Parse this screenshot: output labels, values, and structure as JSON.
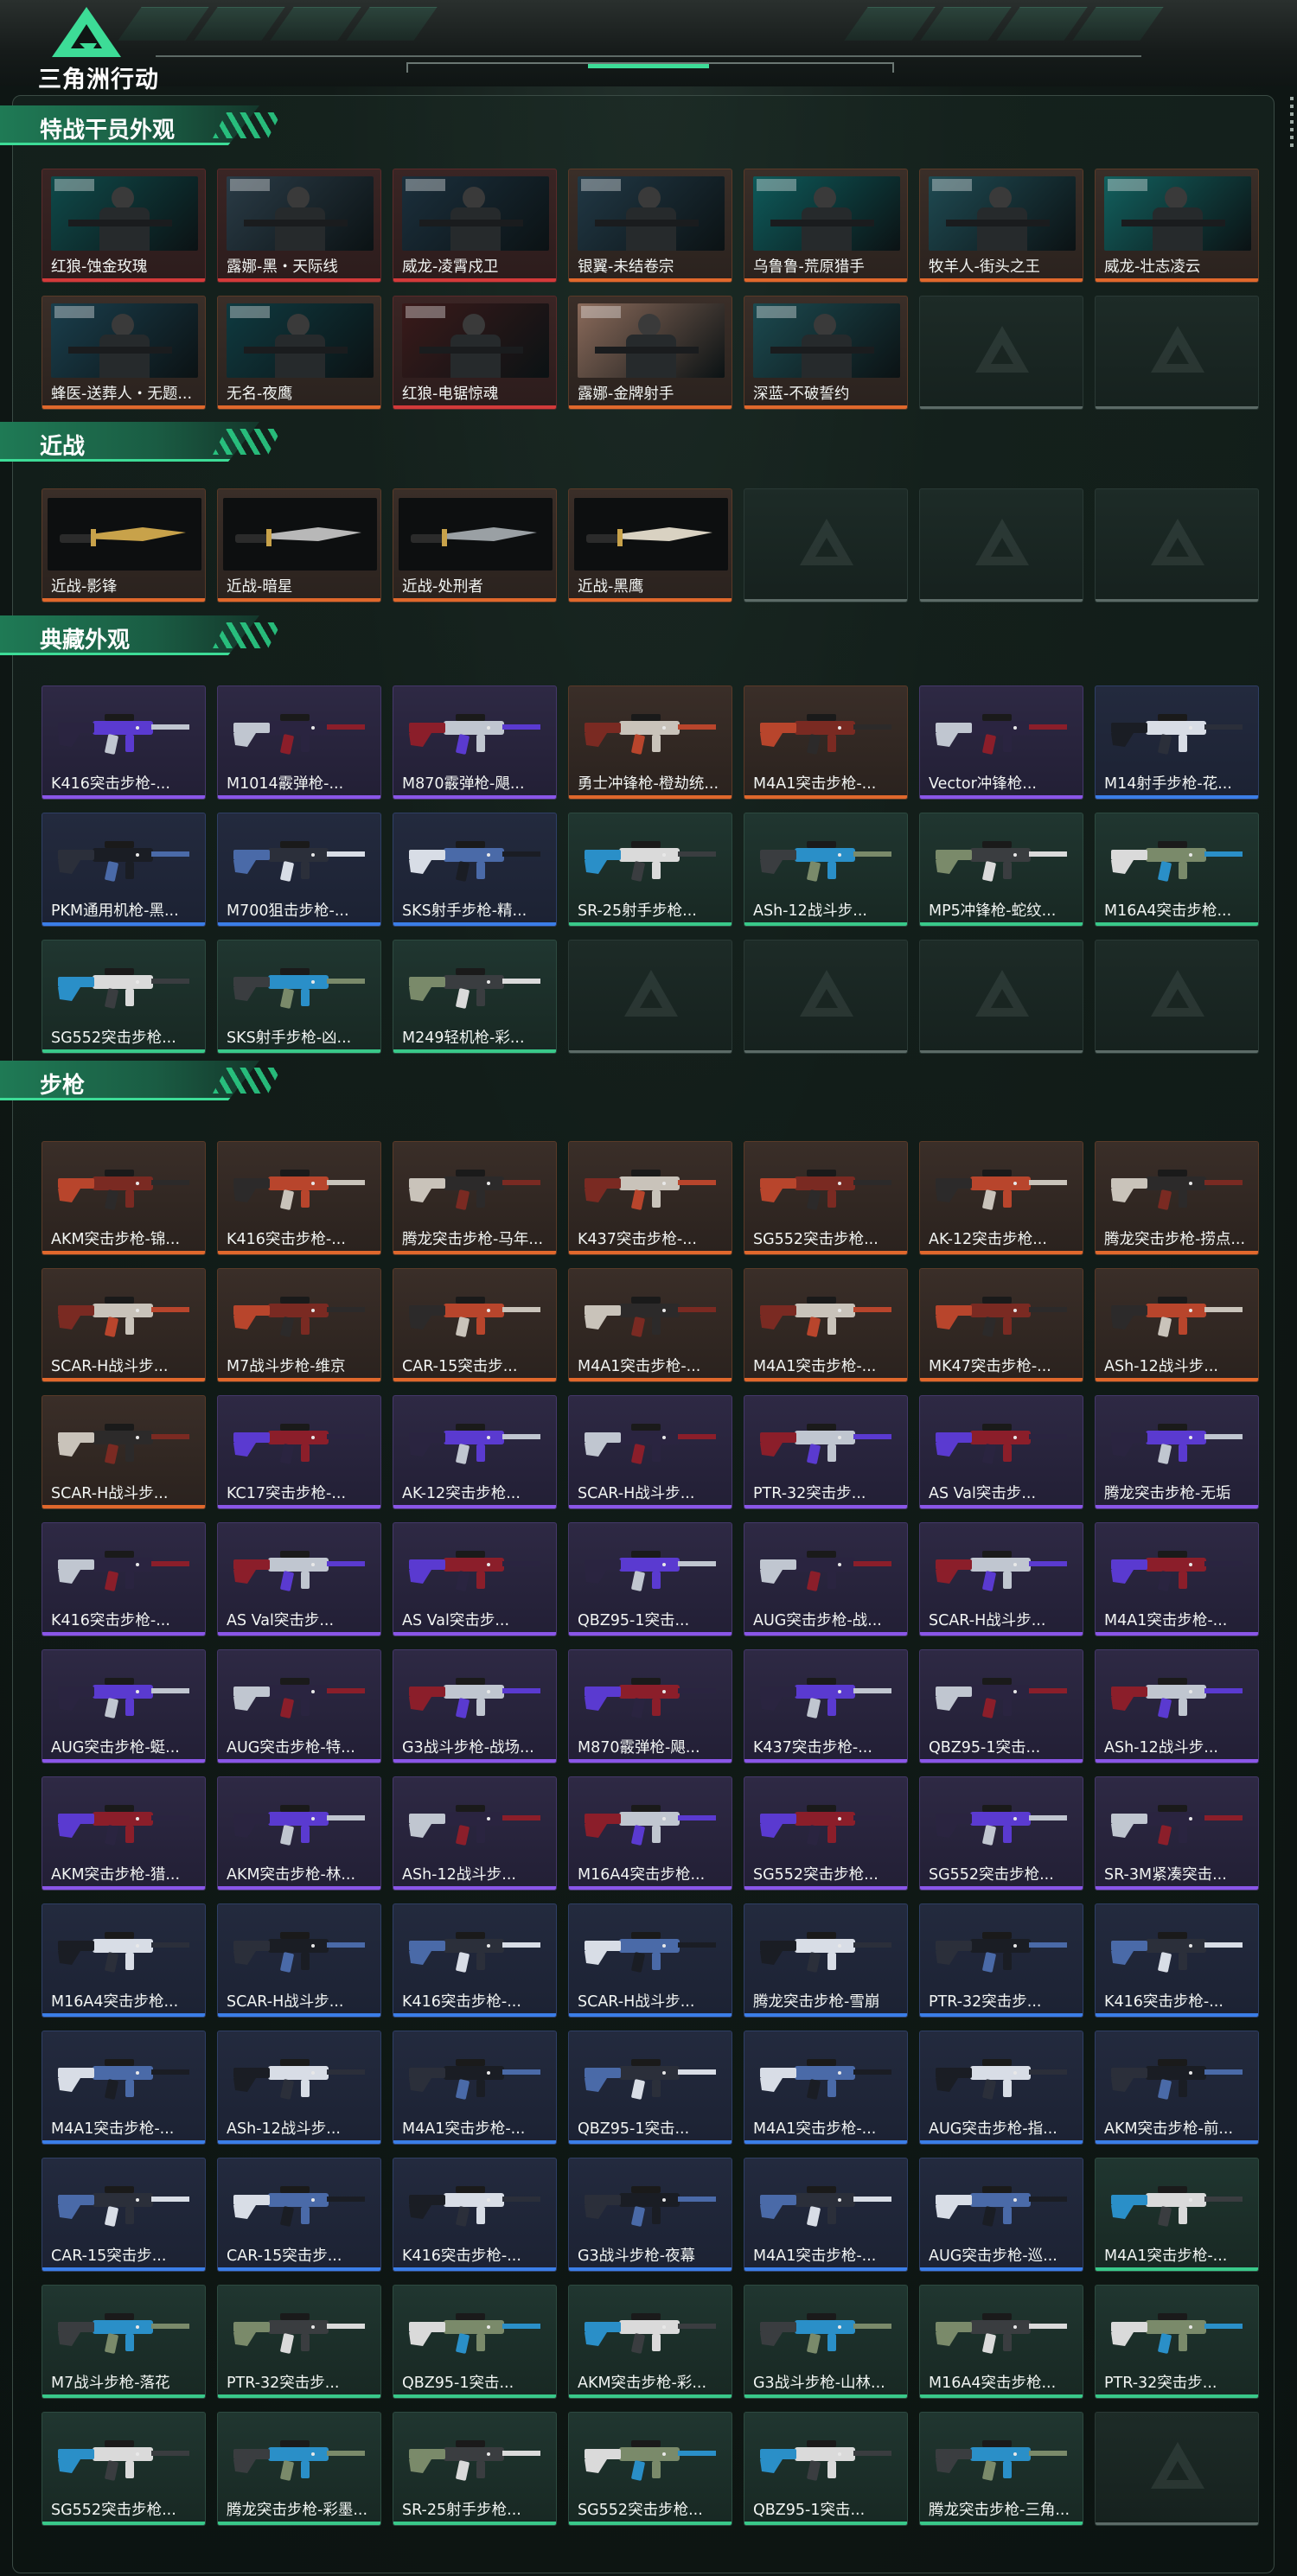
{
  "app": {
    "logo_text": "三角洲行动"
  },
  "colors": {
    "accent": "#3ddc97",
    "orange": "#e0682c",
    "red": "#d33a3a",
    "purple": "#8a56e8",
    "blue": "#3b7ee8",
    "green": "#39c98a"
  },
  "sections": [
    {
      "title": "特战干员外观",
      "kind": "operator",
      "items": [
        {
          "label": "红狼-蚀金玫瑰",
          "rarity": "red"
        },
        {
          "label": "露娜-黑・天际线",
          "rarity": "red"
        },
        {
          "label": "威龙-凌霄戍卫",
          "rarity": "red"
        },
        {
          "label": "银翼-未结卷宗",
          "rarity": "orange"
        },
        {
          "label": "乌鲁鲁-荒原猎手",
          "rarity": "orange"
        },
        {
          "label": "牧羊人-街头之王",
          "rarity": "orange"
        },
        {
          "label": "威龙-壮志凌云",
          "rarity": "orange"
        },
        {
          "label": "蜂医-送葬人・无题...",
          "rarity": "orange"
        },
        {
          "label": "无名-夜鹰",
          "rarity": "orange"
        },
        {
          "label": "红狼-电锯惊魂",
          "rarity": "red"
        },
        {
          "label": "露娜-金牌射手",
          "rarity": "orange"
        },
        {
          "label": "深蓝-不破誓约",
          "rarity": "orange"
        },
        {
          "label": "",
          "rarity": "empty"
        },
        {
          "label": "",
          "rarity": "empty"
        }
      ]
    },
    {
      "title": "近战",
      "kind": "melee",
      "items": [
        {
          "label": "近战-影锋",
          "rarity": "orange"
        },
        {
          "label": "近战-暗星",
          "rarity": "orange"
        },
        {
          "label": "近战-处刑者",
          "rarity": "orange"
        },
        {
          "label": "近战-黑鹰",
          "rarity": "orange"
        },
        {
          "label": "",
          "rarity": "empty"
        },
        {
          "label": "",
          "rarity": "empty"
        },
        {
          "label": "",
          "rarity": "empty"
        }
      ]
    },
    {
      "title": "典藏外观",
      "kind": "gun",
      "items": [
        {
          "label": "K416突击步枪-...",
          "rarity": "purple"
        },
        {
          "label": "M1014霰弹枪-...",
          "rarity": "purple"
        },
        {
          "label": "M870霰弹枪-飓...",
          "rarity": "purple"
        },
        {
          "label": "勇士冲锋枪-橙劫统...",
          "rarity": "orange"
        },
        {
          "label": "M4A1突击步枪-...",
          "rarity": "orange"
        },
        {
          "label": "Vector冲锋枪...",
          "rarity": "purple"
        },
        {
          "label": "M14射手步枪-花...",
          "rarity": "blue"
        },
        {
          "label": "PKM通用机枪-黑...",
          "rarity": "blue"
        },
        {
          "label": "M700狙击步枪-...",
          "rarity": "blue"
        },
        {
          "label": "SKS射手步枪-精...",
          "rarity": "blue"
        },
        {
          "label": "SR-25射手步枪...",
          "rarity": "green"
        },
        {
          "label": "ASh-12战斗步...",
          "rarity": "green"
        },
        {
          "label": "MP5冲锋枪-蛇纹...",
          "rarity": "green"
        },
        {
          "label": "M16A4突击步枪...",
          "rarity": "green"
        },
        {
          "label": "SG552突击步枪...",
          "rarity": "green"
        },
        {
          "label": "SKS射手步枪-凶...",
          "rarity": "green"
        },
        {
          "label": "M249轻机枪-彩...",
          "rarity": "green"
        },
        {
          "label": "",
          "rarity": "empty"
        },
        {
          "label": "",
          "rarity": "empty"
        },
        {
          "label": "",
          "rarity": "empty"
        },
        {
          "label": "",
          "rarity": "empty"
        }
      ]
    },
    {
      "title": "步枪",
      "kind": "gun",
      "items": [
        {
          "label": "AKM突击步枪-锦...",
          "rarity": "orange"
        },
        {
          "label": "K416突击步枪-...",
          "rarity": "orange"
        },
        {
          "label": "腾龙突击步枪-马年...",
          "rarity": "orange"
        },
        {
          "label": "K437突击步枪-...",
          "rarity": "orange"
        },
        {
          "label": "SG552突击步枪...",
          "rarity": "orange"
        },
        {
          "label": "AK-12突击步枪...",
          "rarity": "orange"
        },
        {
          "label": "腾龙突击步枪-捞点...",
          "rarity": "orange"
        },
        {
          "label": "SCAR-H战斗步...",
          "rarity": "orange"
        },
        {
          "label": "M7战斗步枪-维京",
          "rarity": "orange"
        },
        {
          "label": "CAR-15突击步...",
          "rarity": "orange"
        },
        {
          "label": "M4A1突击步枪-...",
          "rarity": "orange"
        },
        {
          "label": "M4A1突击步枪-...",
          "rarity": "orange"
        },
        {
          "label": "MK47突击步枪-...",
          "rarity": "orange"
        },
        {
          "label": "ASh-12战斗步...",
          "rarity": "orange"
        },
        {
          "label": "SCAR-H战斗步...",
          "rarity": "orange"
        },
        {
          "label": "KC17突击步枪-...",
          "rarity": "purple"
        },
        {
          "label": "AK-12突击步枪...",
          "rarity": "purple"
        },
        {
          "label": "SCAR-H战斗步...",
          "rarity": "purple"
        },
        {
          "label": "PTR-32突击步...",
          "rarity": "purple"
        },
        {
          "label": "AS Val突击步...",
          "rarity": "purple"
        },
        {
          "label": "腾龙突击步枪-无垢",
          "rarity": "purple"
        },
        {
          "label": "K416突击步枪-...",
          "rarity": "purple"
        },
        {
          "label": "AS Val突击步...",
          "rarity": "purple"
        },
        {
          "label": "AS Val突击步...",
          "rarity": "purple"
        },
        {
          "label": "QBZ95-1突击...",
          "rarity": "purple"
        },
        {
          "label": "AUG突击步枪-战...",
          "rarity": "purple"
        },
        {
          "label": "SCAR-H战斗步...",
          "rarity": "purple"
        },
        {
          "label": "M4A1突击步枪-...",
          "rarity": "purple"
        },
        {
          "label": "AUG突击步枪-蜓...",
          "rarity": "purple"
        },
        {
          "label": "AUG突击步枪-特...",
          "rarity": "purple"
        },
        {
          "label": "G3战斗步枪-战场...",
          "rarity": "purple"
        },
        {
          "label": "M870霰弹枪-飓...",
          "rarity": "purple"
        },
        {
          "label": "K437突击步枪-...",
          "rarity": "purple"
        },
        {
          "label": "QBZ95-1突击...",
          "rarity": "purple"
        },
        {
          "label": "ASh-12战斗步...",
          "rarity": "purple"
        },
        {
          "label": "AKM突击步枪-猎...",
          "rarity": "purple"
        },
        {
          "label": "AKM突击步枪-林...",
          "rarity": "purple"
        },
        {
          "label": "ASh-12战斗步...",
          "rarity": "purple"
        },
        {
          "label": "M16A4突击步枪...",
          "rarity": "purple"
        },
        {
          "label": "SG552突击步枪...",
          "rarity": "purple"
        },
        {
          "label": "SG552突击步枪...",
          "rarity": "purple"
        },
        {
          "label": "SR-3M紧凑突击...",
          "rarity": "purple"
        },
        {
          "label": "M16A4突击步枪...",
          "rarity": "blue"
        },
        {
          "label": "SCAR-H战斗步...",
          "rarity": "blue"
        },
        {
          "label": "K416突击步枪-...",
          "rarity": "blue"
        },
        {
          "label": "SCAR-H战斗步...",
          "rarity": "blue"
        },
        {
          "label": "腾龙突击步枪-雪崩",
          "rarity": "blue"
        },
        {
          "label": "PTR-32突击步...",
          "rarity": "blue"
        },
        {
          "label": "K416突击步枪-...",
          "rarity": "blue"
        },
        {
          "label": "M4A1突击步枪-...",
          "rarity": "blue"
        },
        {
          "label": "ASh-12战斗步...",
          "rarity": "blue"
        },
        {
          "label": "M4A1突击步枪-...",
          "rarity": "blue"
        },
        {
          "label": "QBZ95-1突击...",
          "rarity": "blue"
        },
        {
          "label": "M4A1突击步枪-...",
          "rarity": "blue"
        },
        {
          "label": "AUG突击步枪-指...",
          "rarity": "blue"
        },
        {
          "label": "AKM突击步枪-前...",
          "rarity": "blue"
        },
        {
          "label": "CAR-15突击步...",
          "rarity": "blue"
        },
        {
          "label": "CAR-15突击步...",
          "rarity": "blue"
        },
        {
          "label": "K416突击步枪-...",
          "rarity": "blue"
        },
        {
          "label": "G3战斗步枪-夜幕",
          "rarity": "blue"
        },
        {
          "label": "M4A1突击步枪-...",
          "rarity": "blue"
        },
        {
          "label": "AUG突击步枪-巡...",
          "rarity": "blue"
        },
        {
          "label": "M4A1突击步枪-...",
          "rarity": "green"
        },
        {
          "label": "M7战斗步枪-落花",
          "rarity": "green"
        },
        {
          "label": "PTR-32突击步...",
          "rarity": "green"
        },
        {
          "label": "QBZ95-1突击...",
          "rarity": "green"
        },
        {
          "label": "AKM突击步枪-彩...",
          "rarity": "green"
        },
        {
          "label": "G3战斗步枪-山林...",
          "rarity": "green"
        },
        {
          "label": "M16A4突击步枪...",
          "rarity": "green"
        },
        {
          "label": "PTR-32突击步...",
          "rarity": "green"
        },
        {
          "label": "SG552突击步枪...",
          "rarity": "green"
        },
        {
          "label": "腾龙突击步枪-彩墨...",
          "rarity": "green"
        },
        {
          "label": "SR-25射手步枪...",
          "rarity": "green"
        },
        {
          "label": "SG552突击步枪...",
          "rarity": "green"
        },
        {
          "label": "QBZ95-1突击...",
          "rarity": "green"
        },
        {
          "label": "腾龙突击步枪-三角...",
          "rarity": "green"
        },
        {
          "label": "",
          "rarity": "empty"
        }
      ]
    }
  ]
}
